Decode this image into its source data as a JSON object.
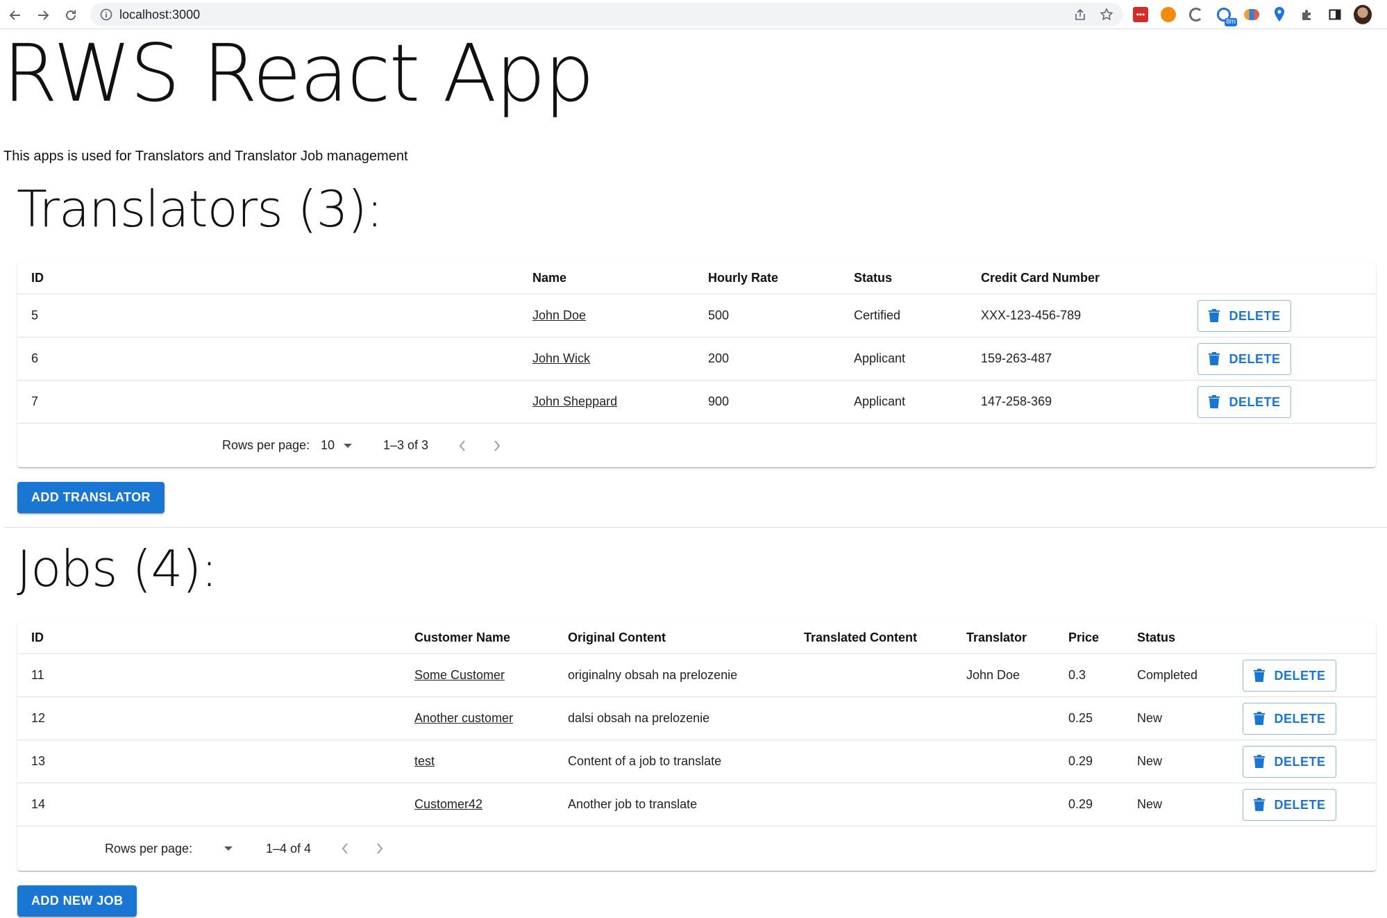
{
  "browser": {
    "url": "localhost:3000",
    "ext_badge": "8m"
  },
  "page": {
    "title": "RWS React App",
    "subtitle": "This apps is used for Translators and Translator Job management"
  },
  "translators": {
    "heading": "Translators (3):",
    "columns": [
      "ID",
      "Name",
      "Hourly Rate",
      "Status",
      "Credit Card Number"
    ],
    "rows": [
      {
        "id": "5",
        "name": "John Doe",
        "rate": "500",
        "status": "Certified",
        "card": "XXX-123-456-789"
      },
      {
        "id": "6",
        "name": "John Wick",
        "rate": "200",
        "status": "Applicant",
        "card": "159-263-487"
      },
      {
        "id": "7",
        "name": "John Sheppard",
        "rate": "900",
        "status": "Applicant",
        "card": "147-258-369"
      }
    ],
    "delete_label": "DELETE",
    "pager": {
      "rows_label": "Rows per page:",
      "rows_value": "10",
      "range": "1–3 of 3"
    },
    "add_label": "ADD TRANSLATOR"
  },
  "jobs": {
    "heading": "Jobs (4):",
    "columns": [
      "ID",
      "Customer Name",
      "Original Content",
      "Translated Content",
      "Translator",
      "Price",
      "Status"
    ],
    "rows": [
      {
        "id": "11",
        "customer": "Some Customer",
        "original": "originalny obsah na prelozenie",
        "translated": "",
        "translator": "John Doe",
        "price": "0.3",
        "status": "Completed"
      },
      {
        "id": "12",
        "customer": "Another customer",
        "original": "dalsi obsah na prelozenie",
        "translated": "",
        "translator": "",
        "price": "0.25",
        "status": "New"
      },
      {
        "id": "13",
        "customer": "test",
        "original": "Content of a job to translate",
        "translated": "",
        "translator": "",
        "price": "0.29",
        "status": "New"
      },
      {
        "id": "14",
        "customer": "Customer42",
        "original": "Another job to translate",
        "translated": "",
        "translator": "",
        "price": "0.29",
        "status": "New"
      }
    ],
    "delete_label": "DELETE",
    "pager": {
      "rows_label": "Rows per page:",
      "rows_value": "",
      "range": "1–4 of 4"
    },
    "add_label": "ADD NEW JOB"
  },
  "colors": {
    "primary": "#1976d2",
    "divider": "#e0e0e0"
  },
  "icons": {
    "back": "arrow-left-icon",
    "forward": "arrow-right-icon",
    "reload": "reload-icon",
    "info": "info-icon",
    "share": "share-icon",
    "bookmark": "star-icon",
    "delete": "trash-icon",
    "dropdown": "caret-down-icon",
    "prev": "chevron-left-icon",
    "next": "chevron-right-icon"
  }
}
